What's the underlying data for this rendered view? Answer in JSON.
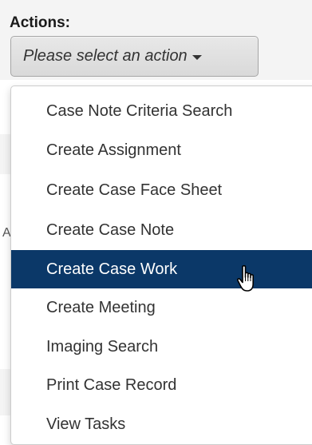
{
  "actions": {
    "label": "Actions:",
    "select_placeholder": "Please select an action",
    "stray_char": "A"
  },
  "menu": {
    "items": [
      {
        "label": "Case Note Criteria Search"
      },
      {
        "label": "Create Assignment"
      },
      {
        "label": "Create Case Face Sheet"
      },
      {
        "label": "Create Case Note"
      },
      {
        "label": "Create Case Work",
        "state": "highlighted"
      },
      {
        "label": "Create Meeting"
      },
      {
        "label": "Imaging Search"
      },
      {
        "label": "Print Case Record"
      },
      {
        "label": "View Tasks"
      }
    ]
  },
  "colors": {
    "highlight_bg": "#0b3868",
    "highlight_text": "#ffffff",
    "text": "#333333",
    "button_bg": "#d9d9d9"
  },
  "icons": {
    "caret": "chevron-down-icon",
    "cursor": "hand-pointer-icon"
  }
}
